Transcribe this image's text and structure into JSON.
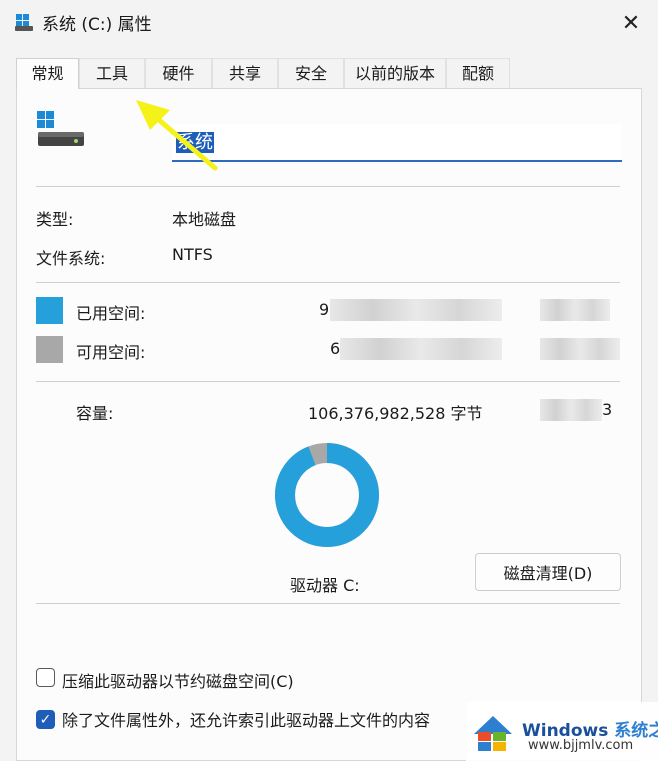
{
  "window": {
    "title": "系统 (C:) 属性",
    "close_label": "✕"
  },
  "tabs": [
    {
      "label": "常规",
      "active": true
    },
    {
      "label": "工具"
    },
    {
      "label": "硬件"
    },
    {
      "label": "共享"
    },
    {
      "label": "安全"
    },
    {
      "label": "以前的版本"
    },
    {
      "label": "配额"
    }
  ],
  "volume": {
    "name_value": "系统"
  },
  "info": {
    "type_label": "类型:",
    "type_value": "本地磁盘",
    "fs_label": "文件系统:",
    "fs_value": "NTFS"
  },
  "space": {
    "used_label": "已用空间:",
    "used_bytes_visible": "9",
    "free_label": "可用空间:",
    "free_bytes_visible": "6",
    "capacity_label": "容量:",
    "capacity_bytes": "106,376,982,528 字节",
    "capacity_gb_visible": "3",
    "used_color": "#26a0da",
    "free_color": "#a8a8a8",
    "used_fraction": 0.94
  },
  "drive": {
    "label": "驱动器 C:",
    "cleanup_button": "磁盘清理(D)"
  },
  "options": {
    "compress_label": "压缩此驱动器以节约磁盘空间(C)",
    "compress_checked": false,
    "index_label": "除了文件属性外，还允许索引此驱动器上文件的内容",
    "index_checked": true
  },
  "watermark": {
    "title_a": "Windows",
    "title_b": " 系统之家",
    "url": "www.bjjmlv.com"
  },
  "colors": {
    "accent": "#1e5db8",
    "arrow": "#f5f21a"
  }
}
